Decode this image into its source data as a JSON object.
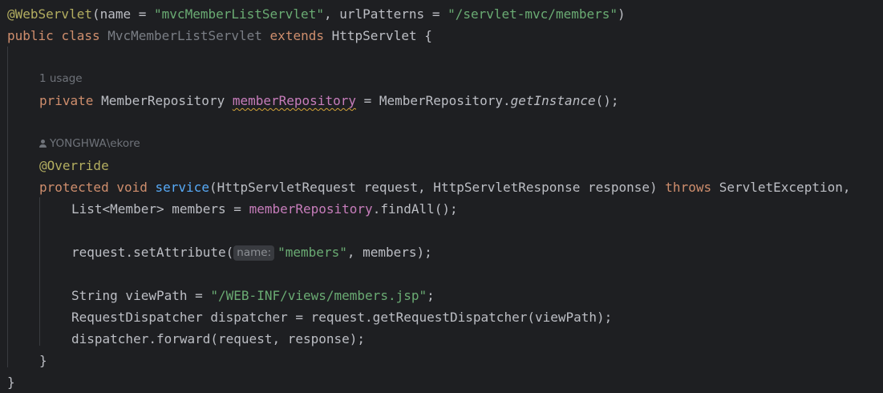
{
  "code": {
    "annotation_webservlet": "@WebServlet",
    "ws_open": "(name = ",
    "ws_name": "\"mvcMemberListServlet\"",
    "ws_mid": ", urlPatterns = ",
    "ws_url": "\"/servlet-mvc/members\"",
    "ws_close": ")",
    "kw_public": "public",
    "kw_class": "class",
    "class_name": "MvcMemberListServlet",
    "kw_extends": "extends",
    "super_class": "HttpServlet {",
    "usage_hint": "1 usage",
    "kw_private": "private",
    "field_type": "MemberRepository",
    "field_name": "memberRepository",
    "field_assign": " = MemberRepository.",
    "get_instance": "getInstance",
    "field_end": "();",
    "author_hint": "YONGHWA\\ekore",
    "override": "@Override",
    "kw_protected": "protected",
    "kw_void": "void",
    "method_name": "service",
    "method_params": "(HttpServletRequest request, HttpServletResponse response) ",
    "kw_throws": "throws",
    "method_throws": " ServletException,",
    "members_decl": "List<Member> members = ",
    "members_repo": "memberRepository",
    "members_call": ".findAll();",
    "set_attr_start": "request.setAttribute(",
    "param_hint_name": "name:",
    "set_attr_key": "\"members\"",
    "set_attr_end": ", members);",
    "viewpath_decl": "String viewPath = ",
    "viewpath_value": "\"/WEB-INF/views/members.jsp\"",
    "viewpath_end": ";",
    "dispatcher_line": "RequestDispatcher dispatcher = request.getRequestDispatcher(viewPath);",
    "forward_line": "dispatcher.forward(request, response);",
    "method_close": "}",
    "class_close": "}"
  }
}
